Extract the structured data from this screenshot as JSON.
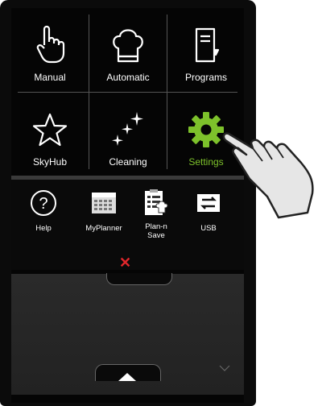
{
  "main_menu": [
    {
      "label": "Manual",
      "icon": "hand-pointer-icon"
    },
    {
      "label": "Automatic",
      "icon": "chef-hat-icon"
    },
    {
      "label": "Programs",
      "icon": "book-icon"
    },
    {
      "label": "SkyHub",
      "icon": "star-icon"
    },
    {
      "label": "Cleaning",
      "icon": "sparkle-icon"
    },
    {
      "label": "Settings",
      "icon": "gear-icon"
    }
  ],
  "secondary_menu": [
    {
      "label": "Help",
      "icon": "question-icon"
    },
    {
      "label": "MyPlanner",
      "icon": "calendar-icon"
    },
    {
      "label": "Plan-n\nSave",
      "icon": "clipboard-icon"
    },
    {
      "label": "USB",
      "icon": "usb-transfer-icon"
    }
  ],
  "colors": {
    "accent_settings": "#7dc12b",
    "close": "#e2272c",
    "background": "#050505"
  }
}
